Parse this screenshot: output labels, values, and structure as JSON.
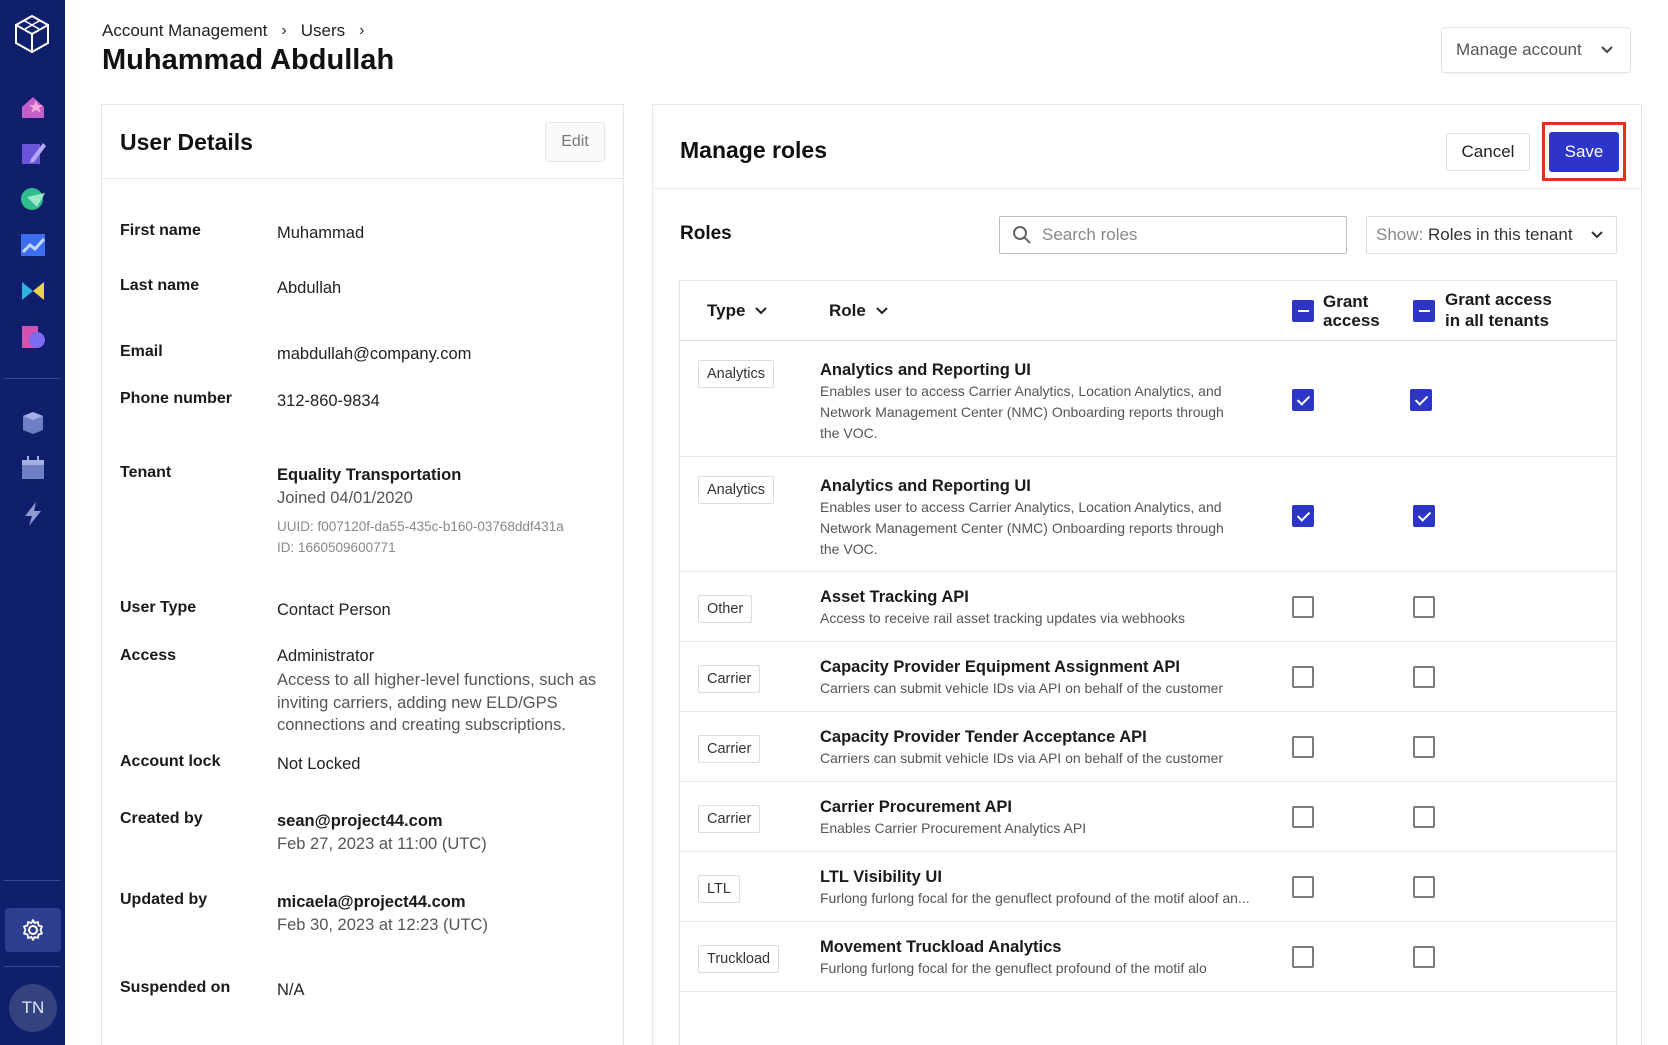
{
  "breadcrumb": {
    "item1": "Account Management",
    "item2": "Users",
    "sep": "›"
  },
  "page": {
    "title": "Muhammad Abdullah",
    "manage_account": "Manage account"
  },
  "sidebar": {
    "avatar_initials": "TN"
  },
  "details": {
    "title": "User Details",
    "edit": "Edit",
    "first_name": {
      "label": "First name",
      "value": "Muhammad"
    },
    "last_name": {
      "label": "Last name",
      "value": "Abdullah"
    },
    "email": {
      "label": "Email",
      "value": "mabdullah@company.com"
    },
    "phone": {
      "label": "Phone number",
      "value": "312-860-9834"
    },
    "tenant": {
      "label": "Tenant",
      "name": "Equality Transportation",
      "joined": "Joined 04/01/2020",
      "uuid": "UUID: f007120f-da55-435c-b160-03768ddf431a",
      "id": "ID: 1660509600771"
    },
    "user_type": {
      "label": "User Type",
      "value": "Contact Person"
    },
    "access": {
      "label": "Access",
      "value": "Administrator",
      "desc": "Access to all higher-level functions, such as inviting carriers, adding new ELD/GPS connections and creating subscriptions."
    },
    "account_lock": {
      "label": "Account lock",
      "value": "Not Locked"
    },
    "created_by": {
      "label": "Created by",
      "value": "sean@project44.com",
      "date": "Feb 27, 2023 at 11:00 (UTC)"
    },
    "updated_by": {
      "label": "Updated by",
      "value": "micaela@project44.com",
      "date": "Feb 30, 2023 at 12:23 (UTC)"
    },
    "suspended_on": {
      "label": "Suspended on",
      "value": "N/A"
    }
  },
  "roles": {
    "title": "Manage roles",
    "cancel": "Cancel",
    "save": "Save",
    "subtitle": "Roles",
    "search_placeholder": "Search roles",
    "show_prefix": "Show:",
    "show_value": "Roles in this tenant",
    "col_type": "Type",
    "col_role": "Role",
    "col_grant": [
      "Grant",
      "access"
    ],
    "col_grant_all": [
      "Grant access",
      "in all tenants"
    ],
    "rows": [
      {
        "type": "Analytics",
        "name": "Analytics and Reporting UI",
        "desc": [
          "Enables user to access Carrier Analytics, Location Analytics, and",
          "Network Management Center (NMC) Onboarding reports through",
          "the VOC."
        ],
        "grant": true,
        "grant_all": true
      },
      {
        "type": "Analytics",
        "name": "Analytics and Reporting UI",
        "desc": [
          "Enables user to access Carrier Analytics, Location Analytics, and",
          "Network Management Center (NMC) Onboarding reports through",
          "the VOC."
        ],
        "grant": true,
        "grant_all": true
      },
      {
        "type": "Other",
        "name": "Asset Tracking API",
        "desc": [
          "Access to receive rail asset tracking updates via webhooks"
        ],
        "grant": false,
        "grant_all": false
      },
      {
        "type": "Carrier",
        "name": "Capacity Provider Equipment Assignment API",
        "desc": [
          "Carriers can submit vehicle IDs via API on behalf of the customer"
        ],
        "grant": false,
        "grant_all": false
      },
      {
        "type": "Carrier",
        "name": "Capacity Provider Tender Acceptance API",
        "desc": [
          "Carriers can submit vehicle IDs via API on behalf of the customer"
        ],
        "grant": false,
        "grant_all": false
      },
      {
        "type": "Carrier",
        "name": "Carrier Procurement API",
        "desc": [
          "Enables Carrier Procurement Analytics API"
        ],
        "grant": false,
        "grant_all": false
      },
      {
        "type": "LTL",
        "name": "LTL Visibility UI",
        "desc": [
          "Furlong furlong focal for the genuflect profound of the motif aloof an..."
        ],
        "grant": false,
        "grant_all": false
      },
      {
        "type": "Truckload",
        "name": "Movement Truckload Analytics",
        "desc": [
          "Furlong furlong focal for the genuflect profound of the motif alo"
        ],
        "grant": false,
        "grant_all": false
      }
    ]
  },
  "colors": {
    "sidebar": "#0f1f6b",
    "primary": "#2d34c8",
    "highlight": "#e0321c"
  },
  "icons": [
    "logo-icon",
    "home-star-icon",
    "pencil-icon",
    "chat-icon",
    "chart-icon",
    "flag-icon",
    "document-icon",
    "box-icon",
    "calendar-icon",
    "lightning-icon",
    "gear-icon",
    "search-icon",
    "chevron-down-icon"
  ]
}
